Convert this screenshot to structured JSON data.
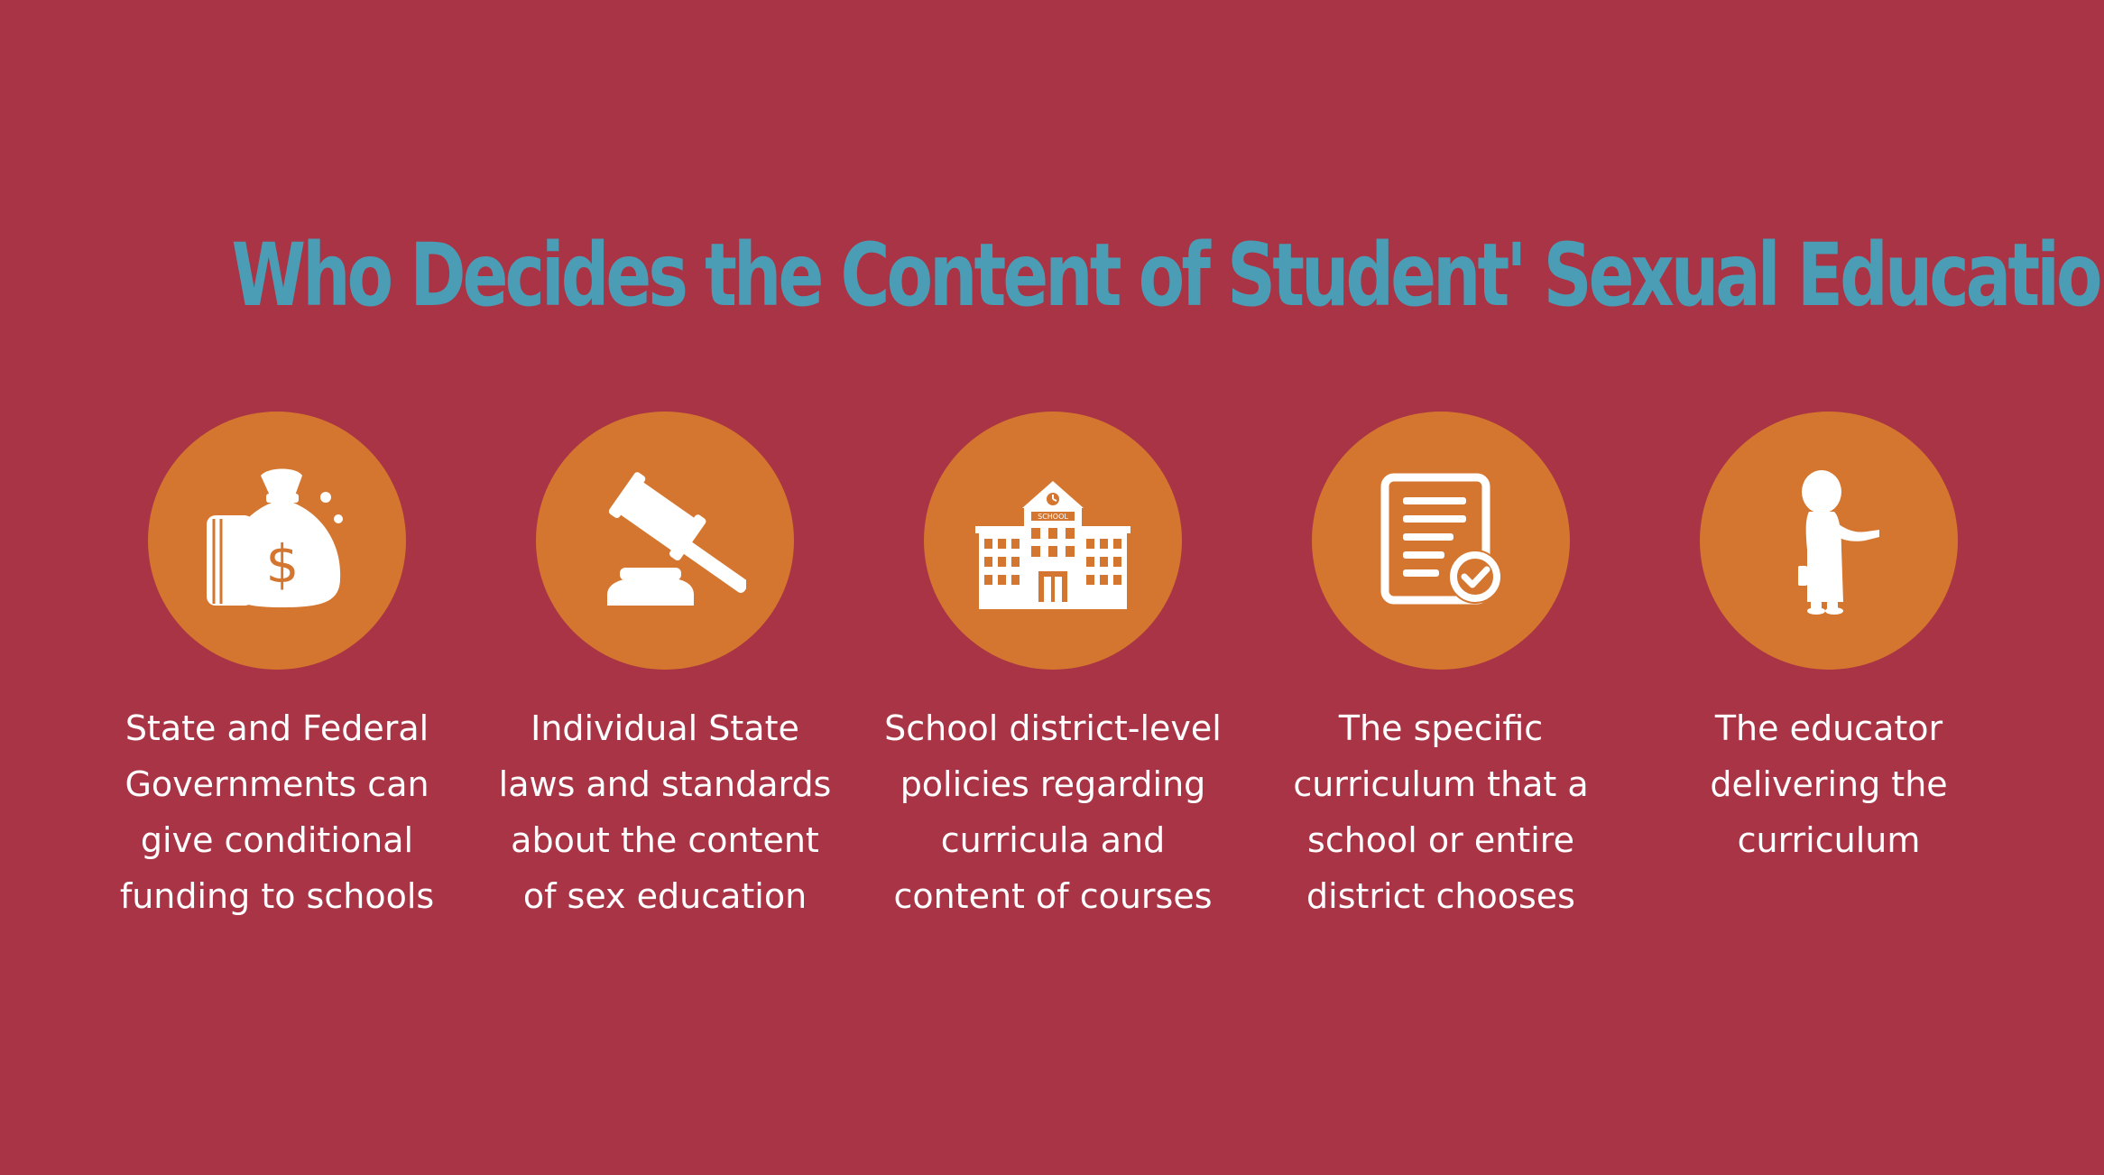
{
  "colors": {
    "background": "#A93445",
    "title": "#4A9DB5",
    "circle": "#D4762F",
    "icon": "#FFFFFF",
    "caption": "#FFFFFF"
  },
  "title": "Who Decides the Content of Student' Sexual Education?",
  "items": [
    {
      "icon": "money-bag-icon",
      "caption": "State and Federal\nGovernments can\ngive conditional\nfunding to schools"
    },
    {
      "icon": "gavel-icon",
      "caption": "Individual State\nlaws and standards\nabout the content\nof sex education"
    },
    {
      "icon": "school-building-icon",
      "icon_text": "SCHOOL",
      "caption": "School district-level\npolicies regarding\ncurricula and\ncontent of courses"
    },
    {
      "icon": "document-check-icon",
      "caption": "The specific\ncurriculum that a\nschool or entire\ndistrict chooses"
    },
    {
      "icon": "teacher-icon",
      "caption": "The educator\ndelivering the\ncurriculum"
    }
  ]
}
